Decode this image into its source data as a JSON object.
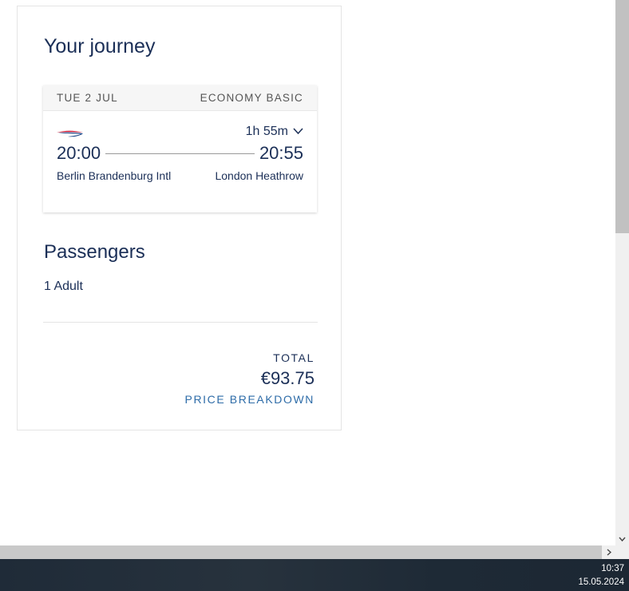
{
  "journey": {
    "title": "Your journey",
    "date": "TUE 2 JUL",
    "fare_class": "ECONOMY BASIC",
    "duration": "1h 55m",
    "depart_time": "20:00",
    "arrive_time": "20:55",
    "origin": "Berlin Brandenburg Intl",
    "destination": "London Heathrow"
  },
  "passengers": {
    "title": "Passengers",
    "count": "1 Adult"
  },
  "total": {
    "label": "TOTAL",
    "amount": "€93.75",
    "breakdown_link": "PRICE BREAKDOWN"
  },
  "taskbar": {
    "time": "10:37",
    "date": "15.05.2024"
  },
  "icons": {
    "airline_logo": "british-airways-speedmarque-icon",
    "expand": "chevron-down-icon",
    "scroll_down": "scroll-down-arrow",
    "scroll_right": "scroll-right-arrow"
  },
  "colors": {
    "heading": "#1b2f57",
    "link": "#2e6ca8",
    "logo_red": "#c8102e",
    "logo_blue": "#1f4a8a"
  }
}
